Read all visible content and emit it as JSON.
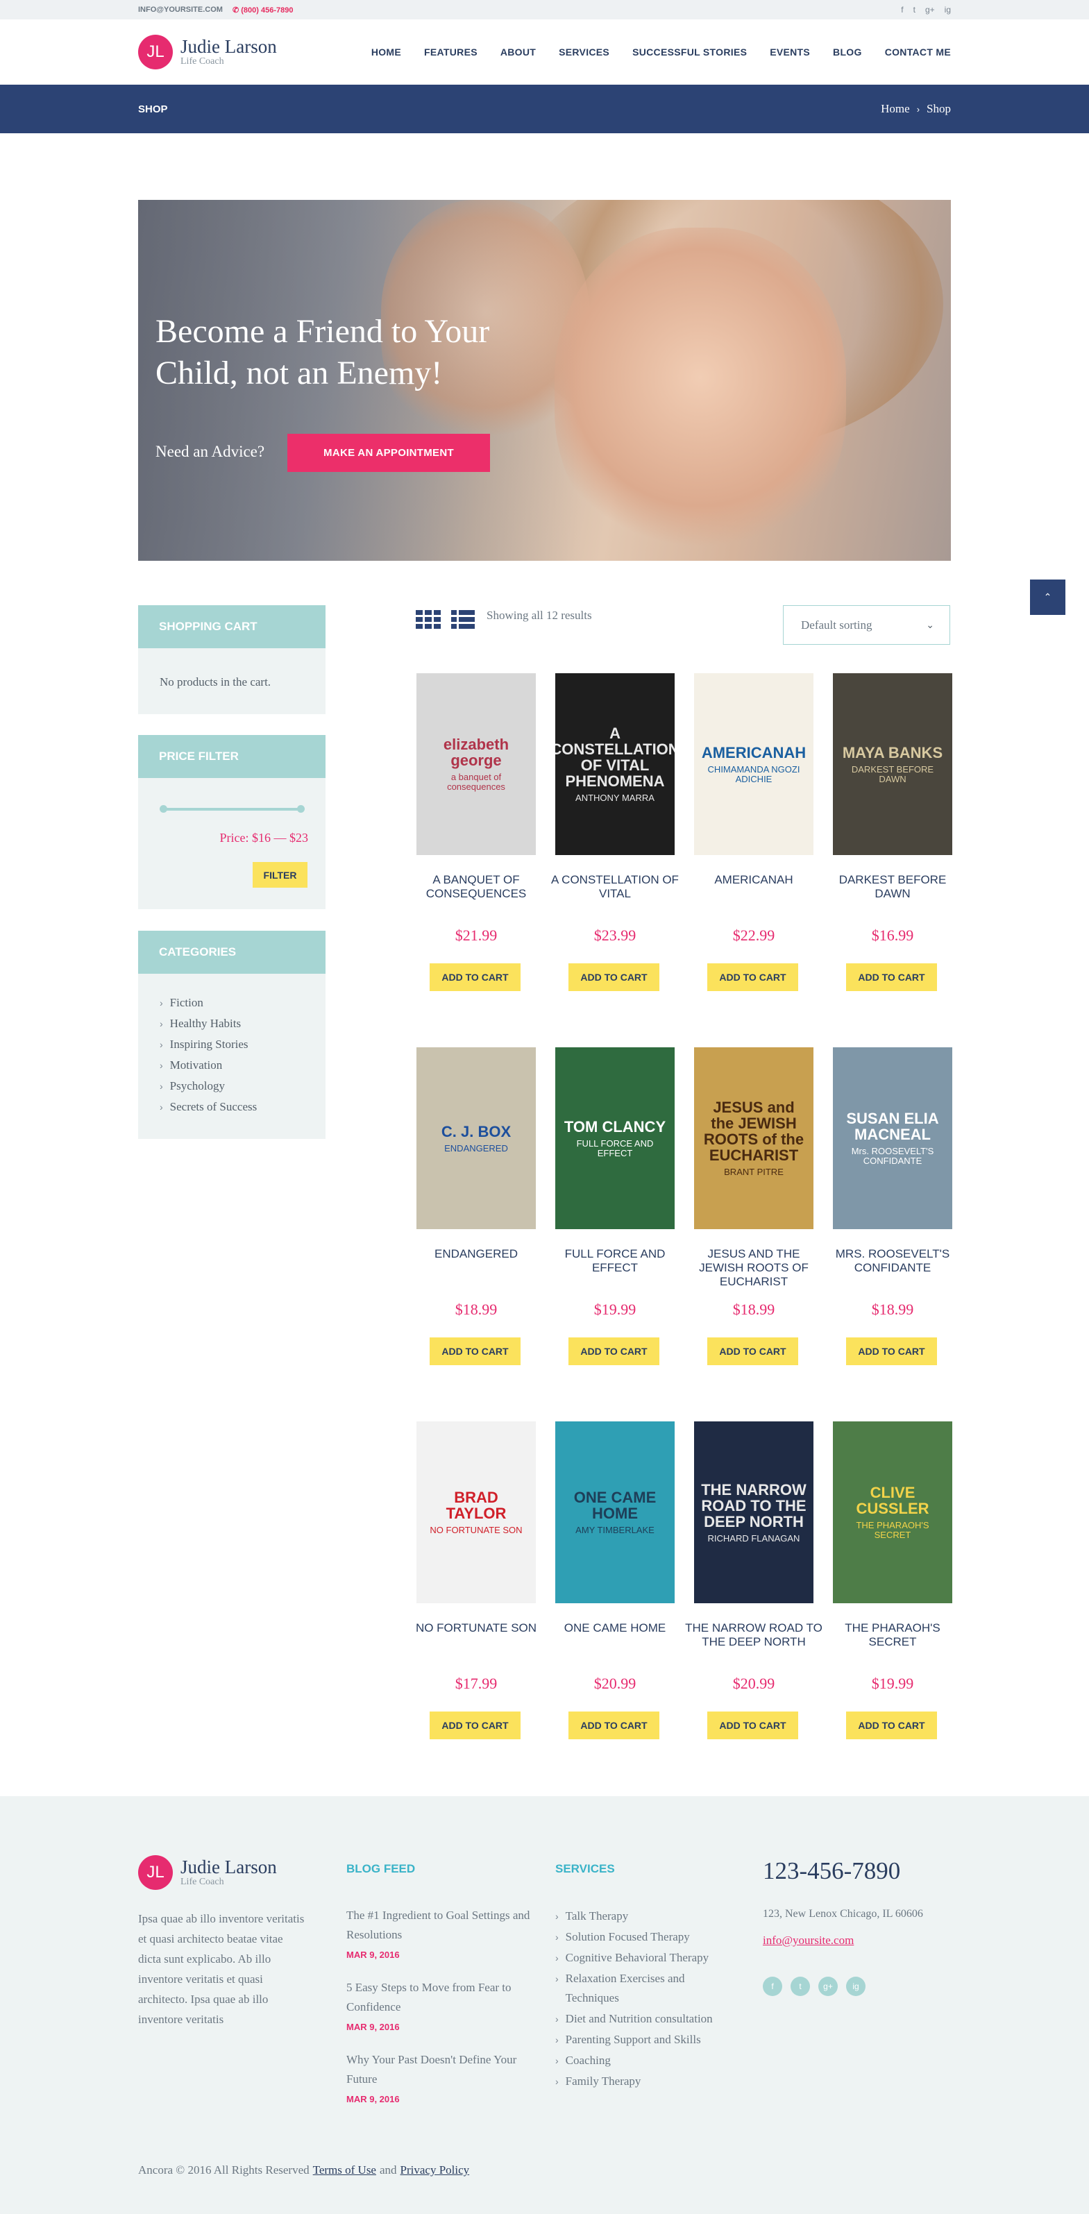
{
  "topbar": {
    "email": "INFO@YOURSITE.COM",
    "phone": "(800) 456-7890"
  },
  "social_top": [
    "f",
    "t",
    "g+",
    "ig"
  ],
  "brand": {
    "initials": "JL",
    "name": "Judie Larson",
    "tagline": "Life Coach"
  },
  "nav": [
    "HOME",
    "FEATURES",
    "ABOUT",
    "SERVICES",
    "SUCCESSFUL STORIES",
    "EVENTS",
    "BLOG",
    "CONTACT ME"
  ],
  "page": {
    "title": "SHOP",
    "breadcrumb": [
      "Home",
      "Shop"
    ]
  },
  "hero": {
    "heading": "Become a Friend to Your Child, not an Enemy!",
    "advice": "Need an Advice?",
    "button": "MAKE AN APPOINTMENT"
  },
  "sidebar": {
    "cart": {
      "title": "SHOPPING CART",
      "empty": "No products in the cart."
    },
    "price_filter": {
      "title": "PRICE FILTER",
      "price_label": "Price:",
      "range": "$16 — $23",
      "button": "FILTER"
    },
    "categories": {
      "title": "CATEGORIES",
      "items": [
        "Fiction",
        "Healthy Habits",
        "Inspiring Stories",
        "Motivation",
        "Psychology",
        "Secrets of Success"
      ]
    }
  },
  "toolbar": {
    "result_count": "Showing all 12 results",
    "sort": "Default sorting"
  },
  "cart_button": "ADD TO CART",
  "products": [
    {
      "title": "A BANQUET OF CONSEQUENCES",
      "price": "$21.99",
      "cover_text": "elizabeth george",
      "cover_sub": "a banquet of consequences",
      "bg": "#d8d8d8",
      "fg": "#b0344a"
    },
    {
      "title": "A CONSTELLATION OF VITAL",
      "price": "$23.99",
      "cover_text": "A CONSTELLATION OF VITAL PHENOMENA",
      "cover_sub": "ANTHONY MARRA",
      "bg": "#1e1e1e",
      "fg": "#e8e8e8"
    },
    {
      "title": "AMERICANAH",
      "price": "$22.99",
      "cover_text": "AMERICANAH",
      "cover_sub": "CHIMAMANDA NGOZI ADICHIE",
      "bg": "#f4f0e6",
      "fg": "#1a5fa0"
    },
    {
      "title": "DARKEST BEFORE DAWN",
      "price": "$16.99",
      "cover_text": "MAYA BANKS",
      "cover_sub": "DARKEST BEFORE DAWN",
      "bg": "#4a463d",
      "fg": "#d8c9a0"
    },
    {
      "title": "ENDANGERED",
      "price": "$18.99",
      "cover_text": "C. J. BOX",
      "cover_sub": "ENDANGERED",
      "bg": "#c9c2ae",
      "fg": "#1d4f9c"
    },
    {
      "title": "FULL FORCE AND EFFECT",
      "price": "$19.99",
      "cover_text": "TOM CLANCY",
      "cover_sub": "FULL FORCE AND EFFECT",
      "bg": "#2f6b3f",
      "fg": "#ffffff"
    },
    {
      "title": "JESUS AND THE JEWISH ROOTS OF EUCHARIST",
      "price": "$18.99",
      "cover_text": "JESUS and the JEWISH ROOTS of the EUCHARIST",
      "cover_sub": "BRANT PITRE",
      "bg": "#c8a050",
      "fg": "#4a2a10"
    },
    {
      "title": "MRS. ROOSEVELT'S CONFIDANTE",
      "price": "$18.99",
      "cover_text": "SUSAN ELIA MACNEAL",
      "cover_sub": "Mrs. ROOSEVELT'S CONFIDANTE",
      "bg": "#7f97a8",
      "fg": "#ffffff"
    },
    {
      "title": "NO FORTUNATE SON",
      "price": "$17.99",
      "cover_text": "BRAD TAYLOR",
      "cover_sub": "NO FORTUNATE SON",
      "bg": "#f2f2f2",
      "fg": "#d0202a"
    },
    {
      "title": "ONE CAME HOME",
      "price": "$20.99",
      "cover_text": "ONE CAME HOME",
      "cover_sub": "AMY TIMBERLAKE",
      "bg": "#2f9fb4",
      "fg": "#1e3e58"
    },
    {
      "title": "THE NARROW ROAD TO THE DEEP NORTH",
      "price": "$20.99",
      "cover_text": "THE NARROW ROAD TO THE DEEP NORTH",
      "cover_sub": "RICHARD FLANAGAN",
      "bg": "#1f2b44",
      "fg": "#e8e8e8"
    },
    {
      "title": "THE PHARAOH'S SECRET",
      "price": "$19.99",
      "cover_text": "CLIVE CUSSLER",
      "cover_sub": "THE PHARAOH'S SECRET",
      "bg": "#4e7d48",
      "fg": "#f3d34a"
    }
  ],
  "footer": {
    "about": "Ipsa quae ab illo inventore veritatis et quasi architecto beatae vitae dicta sunt explicabo. Ab illo inventore veritatis et quasi architecto. Ipsa quae ab illo inventore veritatis",
    "blog_title": "BLOG FEED",
    "posts": [
      {
        "title": "The #1 Ingredient to Goal Settings and Resolutions",
        "date": "MAR 9, 2016"
      },
      {
        "title": "5 Easy Steps to Move from Fear to Confidence",
        "date": "MAR 9, 2016"
      },
      {
        "title": "Why Your Past Doesn't Define Your Future",
        "date": "MAR 9, 2016"
      }
    ],
    "services_title": "SERVICES",
    "services": [
      "Talk Therapy",
      "Solution Focused Therapy",
      "Cognitive Behavioral Therapy",
      "Relaxation Exercises and Techniques",
      "Diet and Nutrition consultation",
      "Parenting Support and Skills",
      "Coaching",
      "Family Therapy"
    ],
    "phone": "123-456-7890",
    "address": "123, New Lenox Chicago, IL 60606",
    "email": "info@yoursite.com",
    "social": [
      "f",
      "t",
      "g+",
      "ig"
    ],
    "copyright": "Ancora © 2016 All Rights Reserved",
    "terms": "Terms of Use",
    "and": "and",
    "privacy": "Privacy Policy"
  },
  "colors": {
    "accent": "#e62b6f",
    "navy": "#2c4374",
    "teal": "#a6d5d3",
    "yellow": "#fbe25c"
  }
}
